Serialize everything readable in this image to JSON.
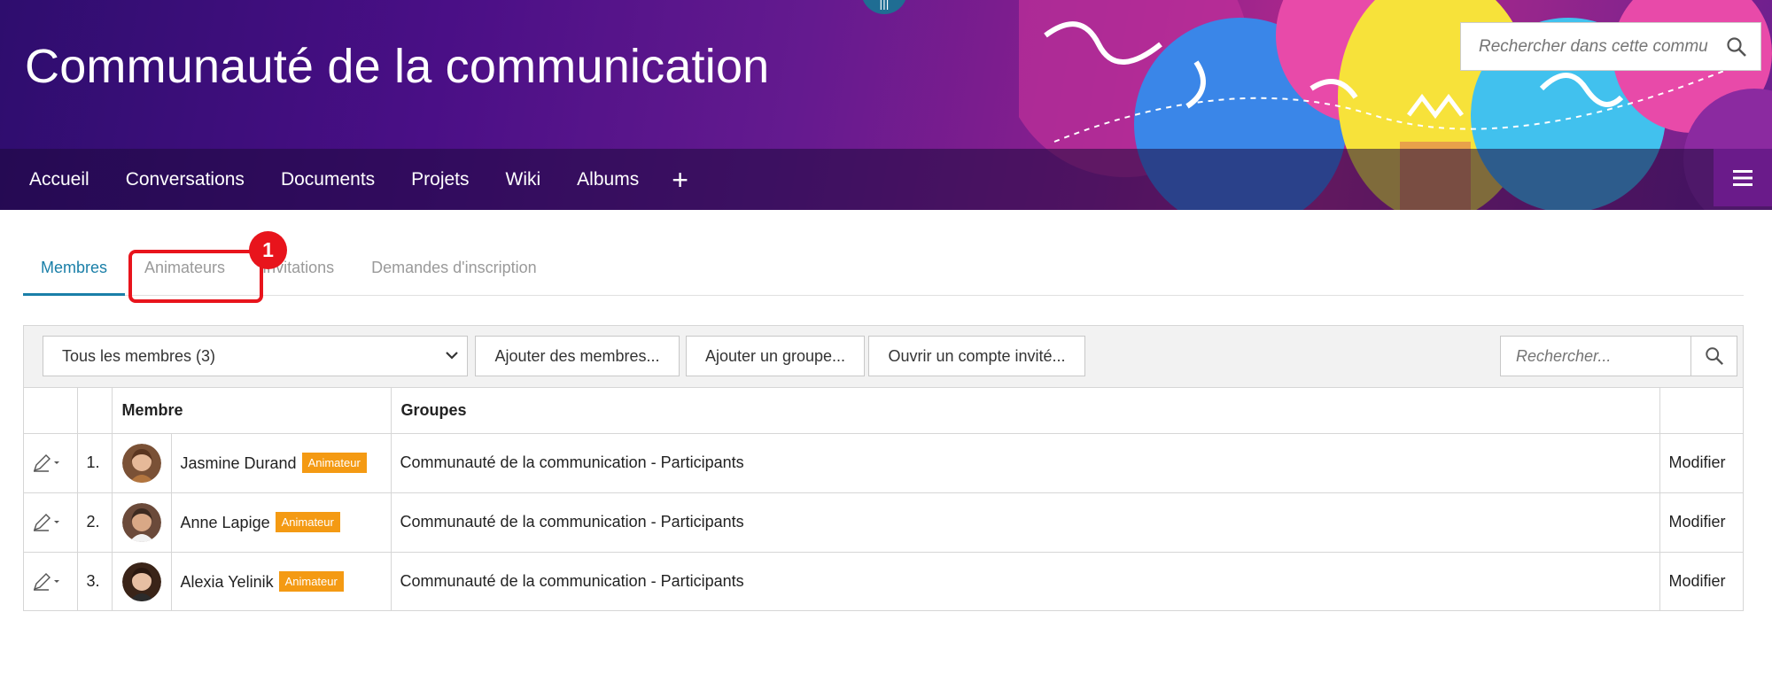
{
  "header": {
    "title": "Communauté de la communication",
    "search_placeholder": "Rechercher dans cette commu",
    "handle_icon": "list-icon"
  },
  "nav": {
    "items": [
      "Accueil",
      "Conversations",
      "Documents",
      "Projets",
      "Wiki",
      "Albums"
    ],
    "plus": "+"
  },
  "tabs": {
    "items": [
      "Membres",
      "Animateurs",
      "Invitations",
      "Demandes d'inscription"
    ],
    "active": "Membres"
  },
  "annotation": {
    "badge": "1"
  },
  "toolbar": {
    "filter_value": "Tous les membres (3)",
    "add_members": "Ajouter des membres...",
    "add_group": "Ajouter un groupe...",
    "guest_account": "Ouvrir un compte invité...",
    "search_placeholder": "Rechercher..."
  },
  "table": {
    "headers": {
      "member": "Membre",
      "groups": "Groupes"
    },
    "rows": [
      {
        "num": "1.",
        "name": "Jasmine Durand",
        "role": "Animateur",
        "group": "Communauté de la communication - Participants",
        "action": "Modifier"
      },
      {
        "num": "2.",
        "name": "Anne Lapige",
        "role": "Animateur",
        "group": "Communauté de la communication - Participants",
        "action": "Modifier"
      },
      {
        "num": "3.",
        "name": "Alexia Yelinik",
        "role": "Animateur",
        "group": "Communauté de la communication - Participants",
        "action": "Modifier"
      }
    ]
  },
  "colors": {
    "accent": "#1a7fa8",
    "badge": "#f49a13",
    "highlight": "#e8141c"
  }
}
